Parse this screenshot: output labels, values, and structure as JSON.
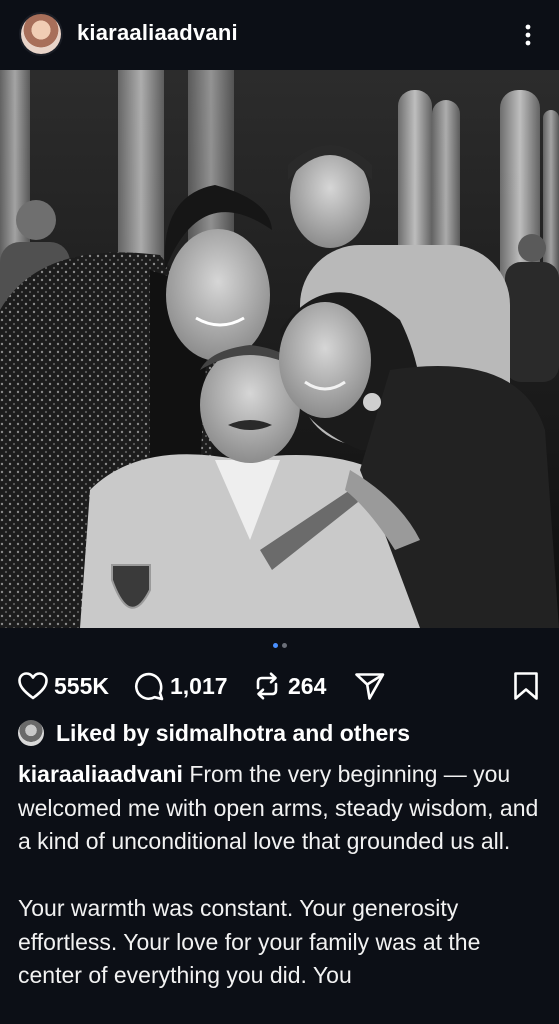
{
  "post": {
    "username": "kiaraaliaadvani",
    "photo_alt": "Black and white group photo",
    "carousel": {
      "current": 1,
      "total": 2
    },
    "colors": {
      "active_dot": "#4a90ff",
      "inactive_dot": "#6b6f78",
      "background": "#0c0f16"
    }
  },
  "actions": {
    "likes": "555K",
    "comments": "1,017",
    "reposts": "264",
    "icons": [
      "heart-icon",
      "comment-icon",
      "repost-icon",
      "share-icon",
      "bookmark-icon"
    ]
  },
  "liked_by": {
    "prefix": "Liked by ",
    "user": "sidmalhotra",
    "suffix": " and others"
  },
  "caption": {
    "username": "kiaraaliaadvani",
    "text": " From the very beginning — you welcomed me with open arms, steady wisdom, and a kind of unconditional love that grounded us all.\n\nYour warmth was constant. Your generosity effortless. Your love for your family was at the center of everything you did. You"
  }
}
